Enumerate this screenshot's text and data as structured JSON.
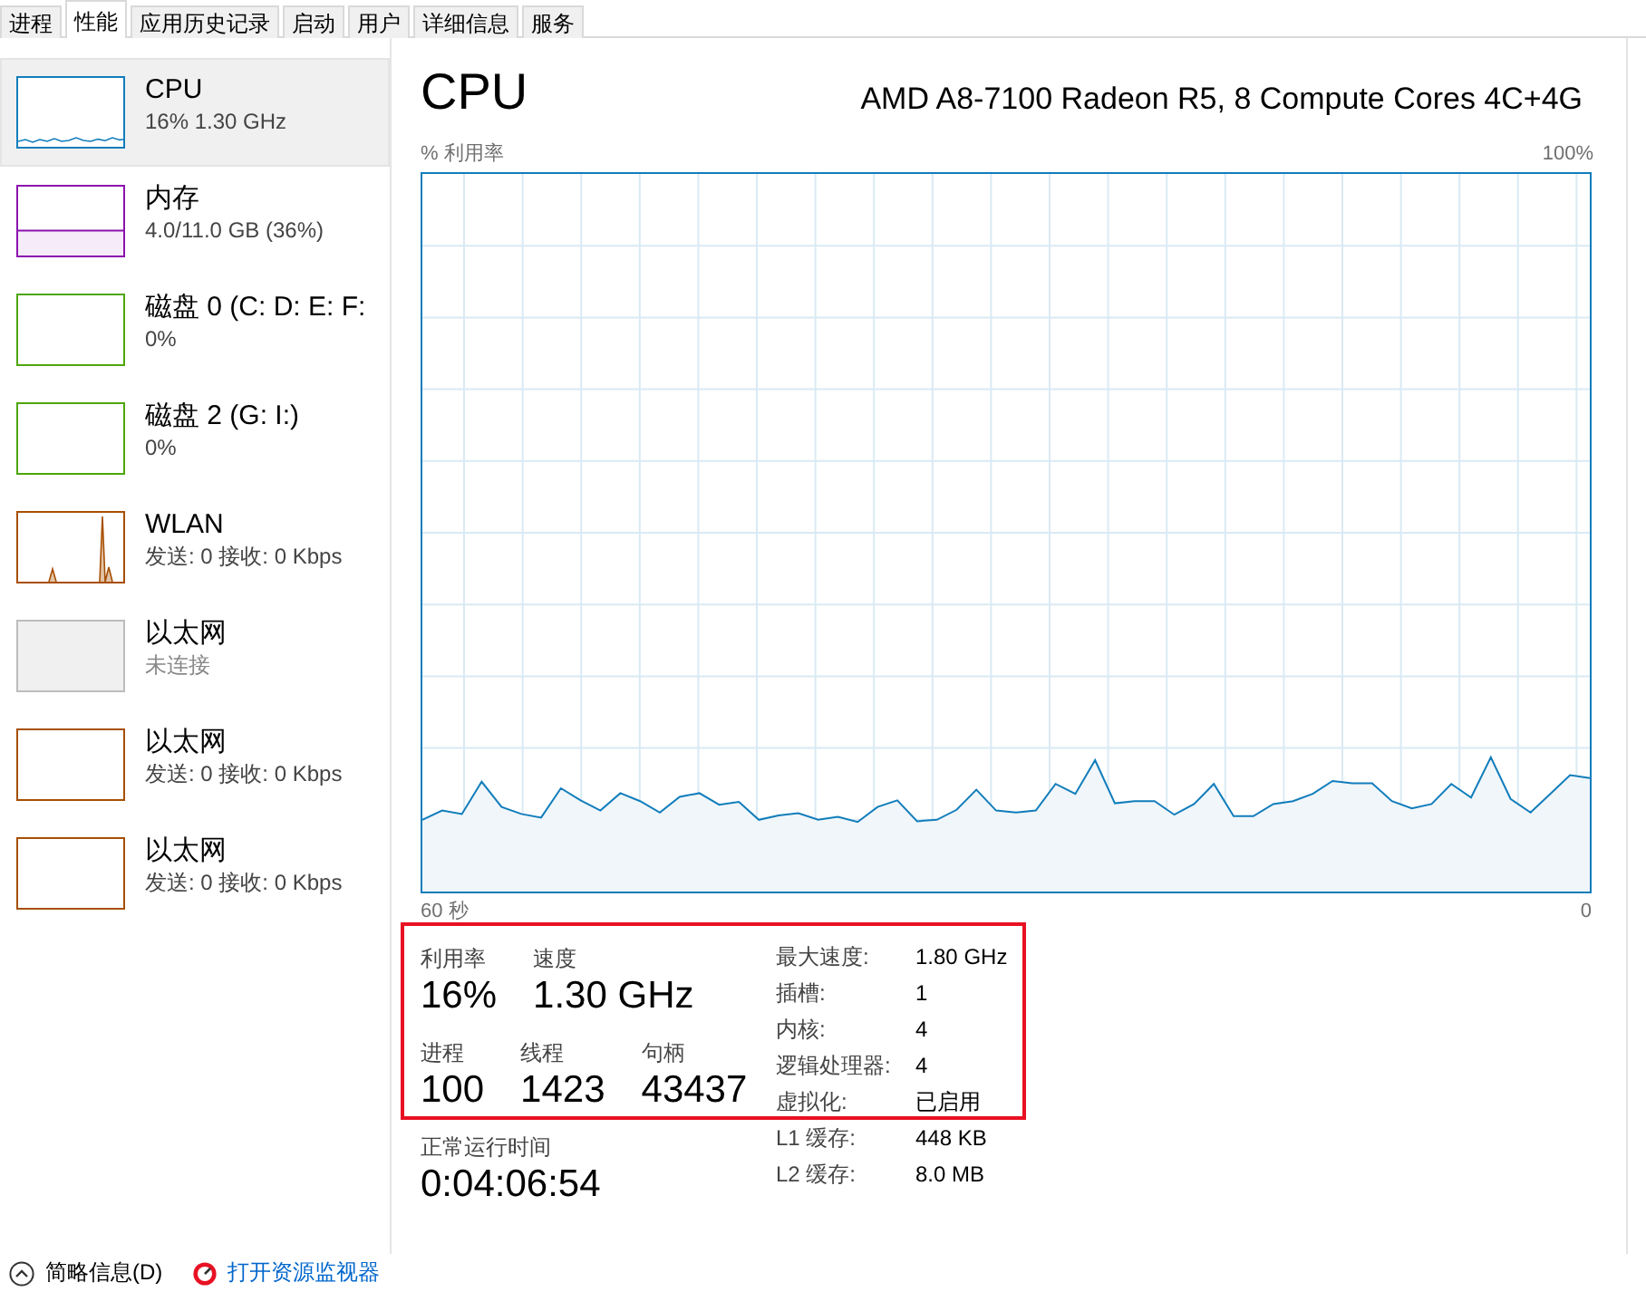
{
  "tabs": [
    {
      "label": "进程",
      "selected": false
    },
    {
      "label": "性能",
      "selected": true
    },
    {
      "label": "应用历史记录",
      "selected": false
    },
    {
      "label": "启动",
      "selected": false
    },
    {
      "label": "用户",
      "selected": false
    },
    {
      "label": "详细信息",
      "selected": false
    },
    {
      "label": "服务",
      "selected": false
    }
  ],
  "sidebar": {
    "items": [
      {
        "kind": "cpu",
        "name": "CPU",
        "detail": "16% 1.30 GHz",
        "color": "#117dbb",
        "selected": true,
        "disabled": false
      },
      {
        "kind": "memory",
        "name": "内存",
        "detail": "4.0/11.0 GB (36%)",
        "color": "#8b12ae",
        "selected": false,
        "disabled": false
      },
      {
        "kind": "disk",
        "name": "磁盘 0 (C: D: E: F:",
        "detail": "0%",
        "color": "#4da60c",
        "selected": false,
        "disabled": false
      },
      {
        "kind": "disk",
        "name": "磁盘 2 (G: I:)",
        "detail": "0%",
        "color": "#4da60c",
        "selected": false,
        "disabled": false
      },
      {
        "kind": "wlan",
        "name": "WLAN",
        "detail": "发送: 0 接收: 0 Kbps",
        "color": "#a74f01",
        "selected": false,
        "disabled": false
      },
      {
        "kind": "ethernet",
        "name": "以太网",
        "detail": "未连接",
        "selected": false,
        "disabled": true
      },
      {
        "kind": "ethernet",
        "name": "以太网",
        "detail": "发送: 0 接收: 0 Kbps",
        "color": "#a74f01",
        "selected": false,
        "disabled": false
      },
      {
        "kind": "ethernet",
        "name": "以太网",
        "detail": "发送: 0 接收: 0 Kbps",
        "color": "#a74f01",
        "selected": false,
        "disabled": false
      }
    ]
  },
  "panel": {
    "title": "CPU",
    "model": "AMD A8-7100 Radeon R5, 8 Compute Cores 4C+4G",
    "graph": {
      "y_label": "% 利用率",
      "top_label": "100%",
      "x_start_label": "60 秒",
      "x_end_label": "0"
    },
    "stat_rows": [
      {
        "stats": [
          {
            "label": "利用率",
            "value": "16%"
          },
          {
            "label": "速度",
            "value": "1.30 GHz"
          }
        ]
      },
      {
        "stats": [
          {
            "label": "进程",
            "value": "100"
          },
          {
            "label": "线程",
            "value": "1423"
          },
          {
            "label": "句柄",
            "value": "43437"
          }
        ]
      }
    ],
    "uptime": {
      "label": "正常运行时间",
      "value": "0:04:06:54"
    },
    "details": [
      {
        "label": "最大速度:",
        "value": "1.80 GHz"
      },
      {
        "label": "插槽:",
        "value": "1"
      },
      {
        "label": "内核:",
        "value": "4"
      },
      {
        "label": "逻辑处理器:",
        "value": "4"
      },
      {
        "label": "虚拟化:",
        "value": "已启用"
      },
      {
        "label": "L1 缓存:",
        "value": "448 KB"
      },
      {
        "label": "L2 缓存:",
        "value": "8.0 MB"
      }
    ]
  },
  "footer": {
    "items": [
      {
        "kind": "button",
        "label": "简略信息(D)"
      },
      {
        "kind": "link",
        "label": "打开资源监视器"
      }
    ]
  }
}
